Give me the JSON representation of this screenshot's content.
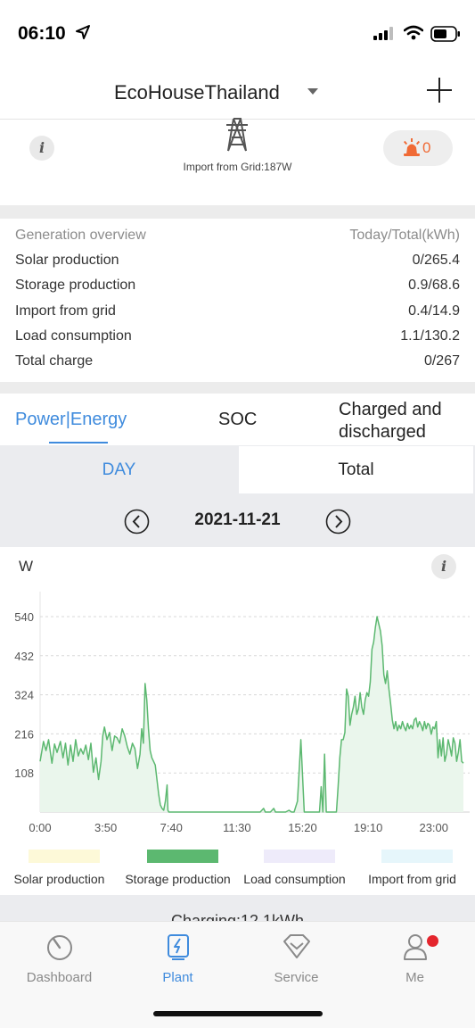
{
  "status_bar": {
    "time": "06:10"
  },
  "header": {
    "plant_name": "EcoHouseThailand"
  },
  "grid": {
    "import_text": "Import from Grid:187W",
    "alarm_count": "0"
  },
  "overview": {
    "heading_left": "Generation overview",
    "heading_right": "Today/Total(kWh)",
    "rows": [
      {
        "label": "Solar production",
        "value": "0/265.4"
      },
      {
        "label": "Storage production",
        "value": "0.9/68.6"
      },
      {
        "label": "Import from grid",
        "value": "0.4/14.9"
      },
      {
        "label": "Load consumption",
        "value": "1.1/130.2"
      },
      {
        "label": "Total charge",
        "value": "0/267"
      }
    ]
  },
  "tabs": [
    {
      "label": "Power|Energy",
      "active": true
    },
    {
      "label": "SOC"
    },
    {
      "label_line1": "Charged and",
      "label_line2": "discharged"
    }
  ],
  "segment": {
    "day": "DAY",
    "total": "Total"
  },
  "date": "2021-11-21",
  "charging_text": "Charging:12.1kWh",
  "nav": {
    "dashboard": "Dashboard",
    "plant": "Plant",
    "service": "Service",
    "me": "Me"
  },
  "colors": {
    "accent": "#3f8bdd",
    "storage": "#5cb870",
    "alarm": "#f06a35",
    "badge": "#e4252d"
  },
  "chart_data": {
    "type": "area",
    "ylabel": "W",
    "yticks": [
      108,
      216,
      324,
      432,
      540
    ],
    "ylim": [
      0,
      540
    ],
    "xticks": [
      "0:00",
      "3:50",
      "7:40",
      "11:30",
      "15:20",
      "19:10",
      "23:00"
    ],
    "xlim": [
      0,
      25
    ],
    "grid": true,
    "legend_position": "bottom",
    "series": [
      {
        "name": "Solar production",
        "color": "#fdf9d8",
        "points": []
      },
      {
        "name": "Storage production",
        "color": "#5cb870",
        "points": [
          [
            0.0,
            140
          ],
          [
            0.2,
            195
          ],
          [
            0.35,
            170
          ],
          [
            0.5,
            200
          ],
          [
            0.7,
            135
          ],
          [
            0.85,
            188
          ],
          [
            1.0,
            165
          ],
          [
            1.2,
            195
          ],
          [
            1.35,
            150
          ],
          [
            1.5,
            190
          ],
          [
            1.65,
            130
          ],
          [
            1.8,
            185
          ],
          [
            1.95,
            140
          ],
          [
            2.1,
            200
          ],
          [
            2.25,
            155
          ],
          [
            2.4,
            175
          ],
          [
            2.55,
            160
          ],
          [
            2.7,
            185
          ],
          [
            2.85,
            145
          ],
          [
            3.0,
            190
          ],
          [
            3.15,
            110
          ],
          [
            3.3,
            150
          ],
          [
            3.45,
            90
          ],
          [
            3.6,
            140
          ],
          [
            3.7,
            210
          ],
          [
            3.8,
            235
          ],
          [
            3.95,
            200
          ],
          [
            4.1,
            220
          ],
          [
            4.25,
            170
          ],
          [
            4.4,
            210
          ],
          [
            4.55,
            205
          ],
          [
            4.7,
            190
          ],
          [
            4.85,
            230
          ],
          [
            5.0,
            210
          ],
          [
            5.15,
            180
          ],
          [
            5.3,
            160
          ],
          [
            5.45,
            190
          ],
          [
            5.6,
            175
          ],
          [
            5.75,
            120
          ],
          [
            5.9,
            160
          ],
          [
            6.0,
            230
          ],
          [
            6.1,
            190
          ],
          [
            6.2,
            355
          ],
          [
            6.3,
            310
          ],
          [
            6.4,
            230
          ],
          [
            6.5,
            170
          ],
          [
            6.6,
            150
          ],
          [
            6.7,
            140
          ],
          [
            6.8,
            130
          ],
          [
            6.9,
            90
          ],
          [
            7.0,
            50
          ],
          [
            7.1,
            20
          ],
          [
            7.2,
            10
          ],
          [
            7.3,
            5
          ],
          [
            7.4,
            30
          ],
          [
            7.5,
            75
          ],
          [
            7.55,
            5
          ],
          [
            7.6,
            0
          ],
          [
            13.0,
            0
          ],
          [
            13.2,
            10
          ],
          [
            13.3,
            0
          ],
          [
            13.6,
            0
          ],
          [
            13.8,
            10
          ],
          [
            13.9,
            0
          ],
          [
            14.5,
            0
          ],
          [
            14.7,
            5
          ],
          [
            14.85,
            0
          ],
          [
            15.0,
            0
          ],
          [
            15.2,
            30
          ],
          [
            15.4,
            200
          ],
          [
            15.5,
            100
          ],
          [
            15.6,
            0
          ],
          [
            16.5,
            0
          ],
          [
            16.6,
            70
          ],
          [
            16.7,
            0
          ],
          [
            16.8,
            160
          ],
          [
            16.9,
            0
          ],
          [
            17.5,
            0
          ],
          [
            17.6,
            70
          ],
          [
            17.7,
            150
          ],
          [
            17.8,
            200
          ],
          [
            17.9,
            200
          ],
          [
            18.0,
            220
          ],
          [
            18.1,
            340
          ],
          [
            18.2,
            320
          ],
          [
            18.3,
            240
          ],
          [
            18.4,
            270
          ],
          [
            18.5,
            290
          ],
          [
            18.6,
            320
          ],
          [
            18.7,
            270
          ],
          [
            18.8,
            285
          ],
          [
            18.9,
            330
          ],
          [
            19.0,
            290
          ],
          [
            19.1,
            270
          ],
          [
            19.2,
            310
          ],
          [
            19.3,
            330
          ],
          [
            19.4,
            320
          ],
          [
            19.5,
            360
          ],
          [
            19.6,
            450
          ],
          [
            19.7,
            470
          ],
          [
            19.8,
            510
          ],
          [
            19.9,
            540
          ],
          [
            20.0,
            520
          ],
          [
            20.1,
            500
          ],
          [
            20.2,
            460
          ],
          [
            20.3,
            380
          ],
          [
            20.4,
            355
          ],
          [
            20.5,
            390
          ],
          [
            20.6,
            340
          ],
          [
            20.7,
            300
          ],
          [
            20.8,
            255
          ],
          [
            20.9,
            230
          ],
          [
            21.0,
            250
          ],
          [
            21.1,
            225
          ],
          [
            21.2,
            240
          ],
          [
            21.3,
            230
          ],
          [
            21.4,
            250
          ],
          [
            21.5,
            235
          ],
          [
            21.6,
            225
          ],
          [
            21.7,
            245
          ],
          [
            21.8,
            230
          ],
          [
            21.9,
            240
          ],
          [
            22.0,
            230
          ],
          [
            22.1,
            255
          ],
          [
            22.2,
            260
          ],
          [
            22.3,
            235
          ],
          [
            22.4,
            250
          ],
          [
            22.5,
            240
          ],
          [
            22.6,
            225
          ],
          [
            22.7,
            250
          ],
          [
            22.8,
            230
          ],
          [
            22.9,
            245
          ],
          [
            23.0,
            240
          ],
          [
            23.1,
            215
          ],
          [
            23.2,
            235
          ],
          [
            23.3,
            230
          ],
          [
            23.4,
            250
          ],
          [
            23.5,
            150
          ],
          [
            23.6,
            200
          ],
          [
            23.7,
            155
          ],
          [
            23.8,
            205
          ],
          [
            23.9,
            140
          ],
          [
            24.0,
            160
          ],
          [
            24.1,
            200
          ],
          [
            24.2,
            180
          ],
          [
            24.3,
            155
          ],
          [
            24.4,
            205
          ],
          [
            24.5,
            190
          ],
          [
            24.6,
            140
          ],
          [
            24.7,
            165
          ],
          [
            24.8,
            200
          ],
          [
            24.9,
            140
          ],
          [
            25.0,
            135
          ]
        ]
      },
      {
        "name": "Load consumption",
        "color": "#eeebfa",
        "points": []
      },
      {
        "name": "Import from grid",
        "color": "#e6f6fb",
        "points": []
      }
    ]
  }
}
